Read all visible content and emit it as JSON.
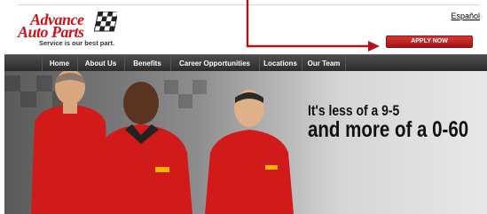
{
  "logo": {
    "line1": "Advance",
    "line2": "Auto Parts",
    "tagline": "Service is our best part."
  },
  "header": {
    "language_link": "Español",
    "apply_button": "APPLY NOW"
  },
  "nav": {
    "items": [
      {
        "label": "Home"
      },
      {
        "label": "About Us"
      },
      {
        "label": "Benefits"
      },
      {
        "label": "Career Opportunities"
      },
      {
        "label": "Locations"
      },
      {
        "label": "Our Team"
      }
    ]
  },
  "hero": {
    "line1": "It's less of a 9-5",
    "line2": "and more of a 0-60"
  },
  "colors": {
    "brand_red": "#c8161d",
    "nav_bg": "#3a3a3a",
    "arrow": "#b5121b"
  }
}
